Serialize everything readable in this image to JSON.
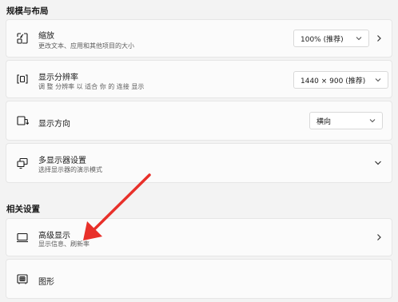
{
  "scale_layout": {
    "heading": "规模与布局",
    "scale": {
      "title": "缩放",
      "subtitle": "更改文本、应用和其他项目的大小",
      "value": "100% (推荐)",
      "icon": "scale-icon"
    },
    "resolution": {
      "title": "显示分辨率",
      "subtitle": "调 整 分辨率 以 适合 你 的 连接 显示",
      "value": "1440 × 900 (推荐)",
      "icon": "resolution-icon"
    },
    "orientation": {
      "title": "显示方向",
      "value": "横向",
      "icon": "orientation-icon"
    },
    "multi_display": {
      "title": "多显示器设置",
      "subtitle": "选择显示器的演示模式",
      "icon": "multi-display-icon"
    }
  },
  "related": {
    "heading": "相关设置",
    "advanced_display": {
      "title": "高级显示",
      "subtitle": "显示信息、刷新率",
      "icon": "monitor-icon"
    },
    "graphics": {
      "title": "图形",
      "icon": "graphics-icon"
    }
  },
  "annotation": {
    "arrow_color": "#e8302a"
  }
}
